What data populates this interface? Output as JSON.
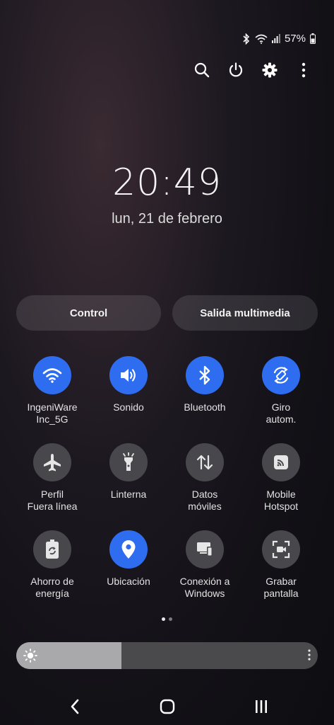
{
  "status_bar": {
    "battery": "57%"
  },
  "clock": {
    "time": "20:49",
    "date": "lun, 21 de febrero"
  },
  "buttons": {
    "control": "Control",
    "media_output": "Salida multimedia"
  },
  "tiles": [
    {
      "label": "IngeniWare\nInc_5G",
      "icon": "wifi-icon",
      "active": true
    },
    {
      "label": "Sonido",
      "icon": "sound-icon",
      "active": true
    },
    {
      "label": "Bluetooth",
      "icon": "bluetooth-icon",
      "active": true
    },
    {
      "label": "Giro\nautom.",
      "icon": "auto-rotate-icon",
      "active": true
    },
    {
      "label": "Perfil\nFuera línea",
      "icon": "airplane-icon",
      "active": false
    },
    {
      "label": "Linterna",
      "icon": "flashlight-icon",
      "active": false
    },
    {
      "label": "Datos\nmóviles",
      "icon": "mobile-data-icon",
      "active": false
    },
    {
      "label": "Mobile\nHotspot",
      "icon": "hotspot-icon",
      "active": false
    },
    {
      "label": "Ahorro de\nenergía",
      "icon": "power-saving-icon",
      "active": false
    },
    {
      "label": "Ubicación",
      "icon": "location-icon",
      "active": true
    },
    {
      "label": "Conexión a\nWindows",
      "icon": "link-to-windows-icon",
      "active": false
    },
    {
      "label": "Grabar\npantalla",
      "icon": "screen-recorder-icon",
      "active": false
    }
  ],
  "brightness": {
    "level": 0.35
  },
  "page_indicator": {
    "pages": 2,
    "current": 1
  },
  "colors": {
    "accent": "#2f6df0",
    "tile_off": "#48484c"
  }
}
